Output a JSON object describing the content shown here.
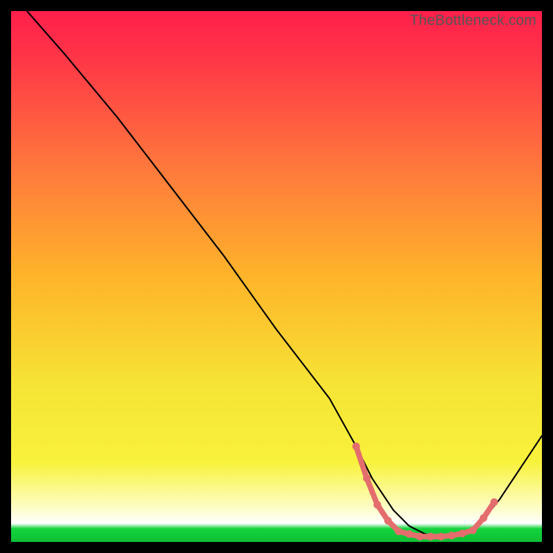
{
  "watermark": "TheBottleneck.com",
  "colors": {
    "black": "#000000",
    "curve": "#000000",
    "dots": "#e46d6d",
    "green": "#12d43c",
    "grad_top": "#ff1f4b",
    "grad_mid": "#ffb42a",
    "grad_yellow": "#f8f23c",
    "grad_pale": "#fdfdbd"
  },
  "chart_data": {
    "type": "line",
    "title": "",
    "xlabel": "",
    "ylabel": "",
    "xlim": [
      0,
      100
    ],
    "ylim": [
      0,
      100
    ],
    "series": [
      {
        "name": "bottleneck-curve",
        "x": [
          3,
          10,
          20,
          30,
          40,
          50,
          60,
          65,
          68,
          72,
          75,
          78,
          80,
          82,
          85,
          88,
          92,
          96,
          100
        ],
        "y": [
          100,
          92,
          80,
          67,
          54,
          40,
          27,
          18,
          12,
          6,
          3,
          1.5,
          1,
          1,
          1.5,
          3,
          8,
          14,
          20
        ]
      }
    ],
    "highlight_dots": {
      "name": "optimal-range",
      "x": [
        65,
        67,
        69,
        71,
        73,
        75,
        77,
        79,
        81,
        83,
        85,
        87,
        89,
        91
      ],
      "y": [
        18,
        12,
        7,
        4,
        2,
        1.5,
        1,
        1,
        1,
        1.2,
        1.6,
        2.2,
        4.5,
        7.5
      ]
    },
    "green_band_y": 0
  }
}
